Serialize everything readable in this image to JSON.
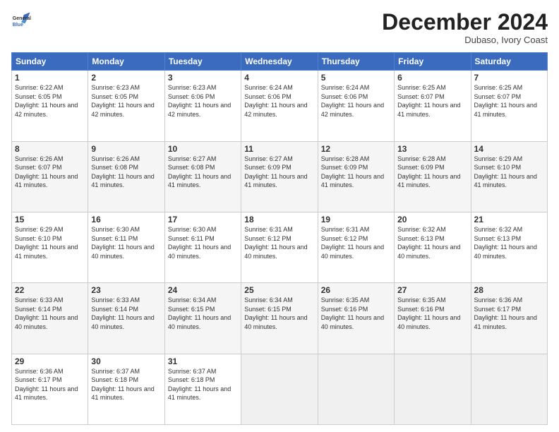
{
  "header": {
    "logo_line1": "General",
    "logo_line2": "Blue",
    "month_title": "December 2024",
    "subtitle": "Dubaso, Ivory Coast"
  },
  "weekdays": [
    "Sunday",
    "Monday",
    "Tuesday",
    "Wednesday",
    "Thursday",
    "Friday",
    "Saturday"
  ],
  "weeks": [
    [
      {
        "day": "1",
        "sunrise": "6:22 AM",
        "sunset": "6:05 PM",
        "daylight": "11 hours and 42 minutes."
      },
      {
        "day": "2",
        "sunrise": "6:23 AM",
        "sunset": "6:05 PM",
        "daylight": "11 hours and 42 minutes."
      },
      {
        "day": "3",
        "sunrise": "6:23 AM",
        "sunset": "6:06 PM",
        "daylight": "11 hours and 42 minutes."
      },
      {
        "day": "4",
        "sunrise": "6:24 AM",
        "sunset": "6:06 PM",
        "daylight": "11 hours and 42 minutes."
      },
      {
        "day": "5",
        "sunrise": "6:24 AM",
        "sunset": "6:06 PM",
        "daylight": "11 hours and 42 minutes."
      },
      {
        "day": "6",
        "sunrise": "6:25 AM",
        "sunset": "6:07 PM",
        "daylight": "11 hours and 41 minutes."
      },
      {
        "day": "7",
        "sunrise": "6:25 AM",
        "sunset": "6:07 PM",
        "daylight": "11 hours and 41 minutes."
      }
    ],
    [
      {
        "day": "8",
        "sunrise": "6:26 AM",
        "sunset": "6:07 PM",
        "daylight": "11 hours and 41 minutes."
      },
      {
        "day": "9",
        "sunrise": "6:26 AM",
        "sunset": "6:08 PM",
        "daylight": "11 hours and 41 minutes."
      },
      {
        "day": "10",
        "sunrise": "6:27 AM",
        "sunset": "6:08 PM",
        "daylight": "11 hours and 41 minutes."
      },
      {
        "day": "11",
        "sunrise": "6:27 AM",
        "sunset": "6:09 PM",
        "daylight": "11 hours and 41 minutes."
      },
      {
        "day": "12",
        "sunrise": "6:28 AM",
        "sunset": "6:09 PM",
        "daylight": "11 hours and 41 minutes."
      },
      {
        "day": "13",
        "sunrise": "6:28 AM",
        "sunset": "6:09 PM",
        "daylight": "11 hours and 41 minutes."
      },
      {
        "day": "14",
        "sunrise": "6:29 AM",
        "sunset": "6:10 PM",
        "daylight": "11 hours and 41 minutes."
      }
    ],
    [
      {
        "day": "15",
        "sunrise": "6:29 AM",
        "sunset": "6:10 PM",
        "daylight": "11 hours and 41 minutes."
      },
      {
        "day": "16",
        "sunrise": "6:30 AM",
        "sunset": "6:11 PM",
        "daylight": "11 hours and 40 minutes."
      },
      {
        "day": "17",
        "sunrise": "6:30 AM",
        "sunset": "6:11 PM",
        "daylight": "11 hours and 40 minutes."
      },
      {
        "day": "18",
        "sunrise": "6:31 AM",
        "sunset": "6:12 PM",
        "daylight": "11 hours and 40 minutes."
      },
      {
        "day": "19",
        "sunrise": "6:31 AM",
        "sunset": "6:12 PM",
        "daylight": "11 hours and 40 minutes."
      },
      {
        "day": "20",
        "sunrise": "6:32 AM",
        "sunset": "6:13 PM",
        "daylight": "11 hours and 40 minutes."
      },
      {
        "day": "21",
        "sunrise": "6:32 AM",
        "sunset": "6:13 PM",
        "daylight": "11 hours and 40 minutes."
      }
    ],
    [
      {
        "day": "22",
        "sunrise": "6:33 AM",
        "sunset": "6:14 PM",
        "daylight": "11 hours and 40 minutes."
      },
      {
        "day": "23",
        "sunrise": "6:33 AM",
        "sunset": "6:14 PM",
        "daylight": "11 hours and 40 minutes."
      },
      {
        "day": "24",
        "sunrise": "6:34 AM",
        "sunset": "6:15 PM",
        "daylight": "11 hours and 40 minutes."
      },
      {
        "day": "25",
        "sunrise": "6:34 AM",
        "sunset": "6:15 PM",
        "daylight": "11 hours and 40 minutes."
      },
      {
        "day": "26",
        "sunrise": "6:35 AM",
        "sunset": "6:16 PM",
        "daylight": "11 hours and 40 minutes."
      },
      {
        "day": "27",
        "sunrise": "6:35 AM",
        "sunset": "6:16 PM",
        "daylight": "11 hours and 40 minutes."
      },
      {
        "day": "28",
        "sunrise": "6:36 AM",
        "sunset": "6:17 PM",
        "daylight": "11 hours and 41 minutes."
      }
    ],
    [
      {
        "day": "29",
        "sunrise": "6:36 AM",
        "sunset": "6:17 PM",
        "daylight": "11 hours and 41 minutes."
      },
      {
        "day": "30",
        "sunrise": "6:37 AM",
        "sunset": "6:18 PM",
        "daylight": "11 hours and 41 minutes."
      },
      {
        "day": "31",
        "sunrise": "6:37 AM",
        "sunset": "6:18 PM",
        "daylight": "11 hours and 41 minutes."
      },
      null,
      null,
      null,
      null
    ]
  ]
}
